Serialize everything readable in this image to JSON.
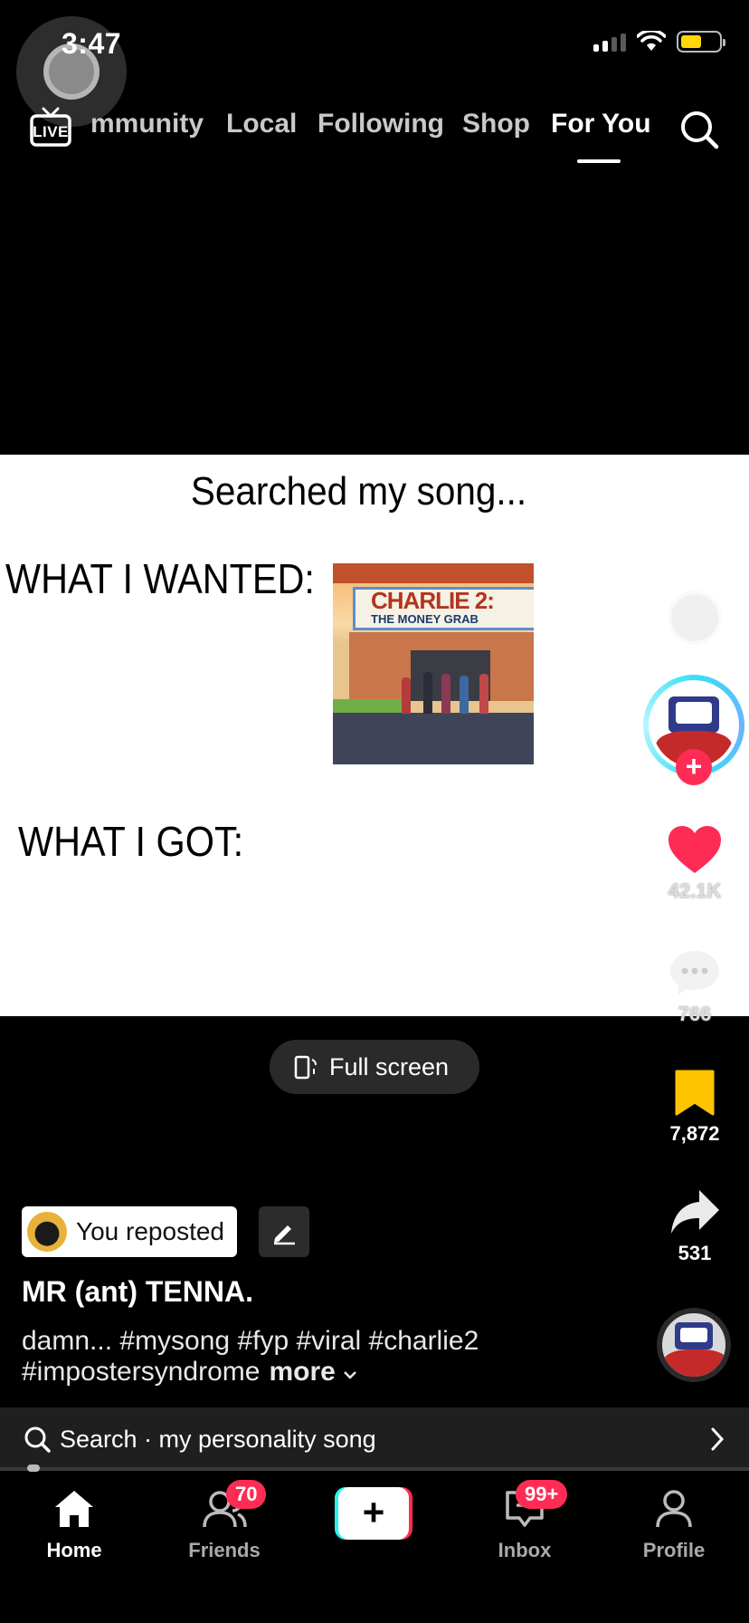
{
  "status_bar": {
    "time": "3:47"
  },
  "top_nav": {
    "live_label": "LIVE",
    "tabs": [
      "mmunity",
      "Local",
      "Following",
      "Shop",
      "For You"
    ],
    "active_tab": "For You"
  },
  "video": {
    "title": "Searched my song...",
    "wanted_label": "WHAT I WANTED:",
    "got_label": "WHAT I GOT:",
    "poster": {
      "line1": "CHARLIE 2:",
      "line2": "THE MONEY GRAB"
    }
  },
  "fullscreen": {
    "label": "Full screen"
  },
  "rail": {
    "likes": "42.1K",
    "comments": "766",
    "saves": "7,872",
    "shares": "531"
  },
  "caption": {
    "repost_label": "You reposted",
    "author": "MR (ant) TENNA.",
    "description": "damn... #mysong #fyp #viral #charlie2 #impostersyndrome",
    "more": "more"
  },
  "search_bar": {
    "label": "Search · my personality song"
  },
  "bottom_nav": {
    "home": "Home",
    "friends": "Friends",
    "friends_badge": "70",
    "inbox": "Inbox",
    "inbox_badge": "99+",
    "profile": "Profile"
  },
  "colors": {
    "accent": "#fe2c55",
    "save": "#ffc400",
    "like": "#fe2c55",
    "cyan": "#25f4ee"
  }
}
